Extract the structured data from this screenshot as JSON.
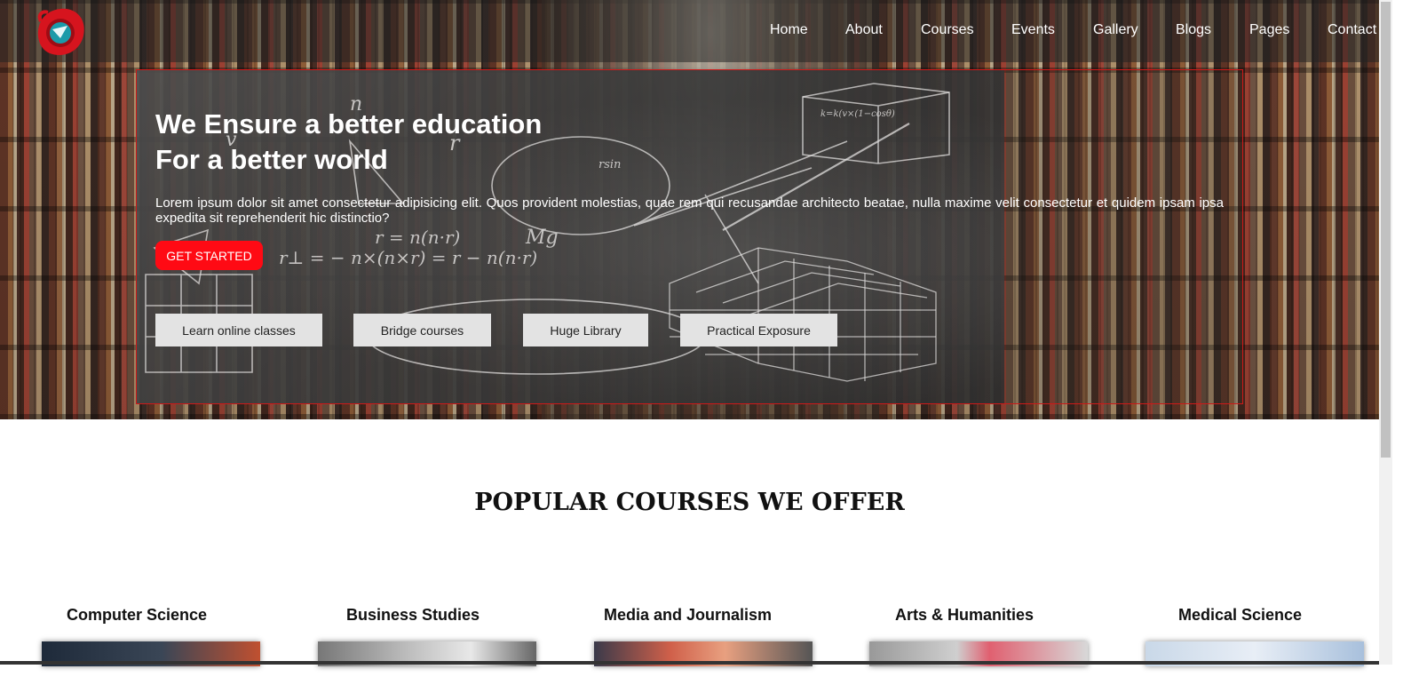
{
  "nav": {
    "logo": "logo-icon",
    "links": [
      "Home",
      "About",
      "Courses",
      "Events",
      "Gallery",
      "Blogs",
      "Pages",
      "Contact"
    ]
  },
  "hero": {
    "title_line1": "We Ensure a better education",
    "title_line2": "For a better world",
    "text": "Lorem ipsum dolor sit amet consectetur adipisicing elit. Quos provident molestias, quae rem qui recusandae architecto beatae, nulla maxime velit consectetur et quidem ipsam ipsa expedita sit reprehenderit hic distinctio?",
    "cta": "GET STARTED",
    "features": [
      "Learn online classes",
      "Bridge courses",
      "Huge Library",
      "Practical Exposure"
    ],
    "board_formulas": [
      "r = n(n·r)",
      "r⊥ = − n×(n×r) = r − n(n·r)",
      "Mg",
      "n",
      "v",
      "k=k(v×(1−cosθ)",
      "rsin"
    ]
  },
  "courses": {
    "title": "POPULAR COURSES WE OFFER",
    "items": [
      "Computer Science",
      "Business Studies",
      "Media and Journalism",
      "Arts & Humanities",
      "Medical Science"
    ]
  },
  "colors": {
    "accent": "#ff0a14",
    "panel_border": "#d01818",
    "nav_overlay": "rgba(35,35,35,.55)"
  }
}
